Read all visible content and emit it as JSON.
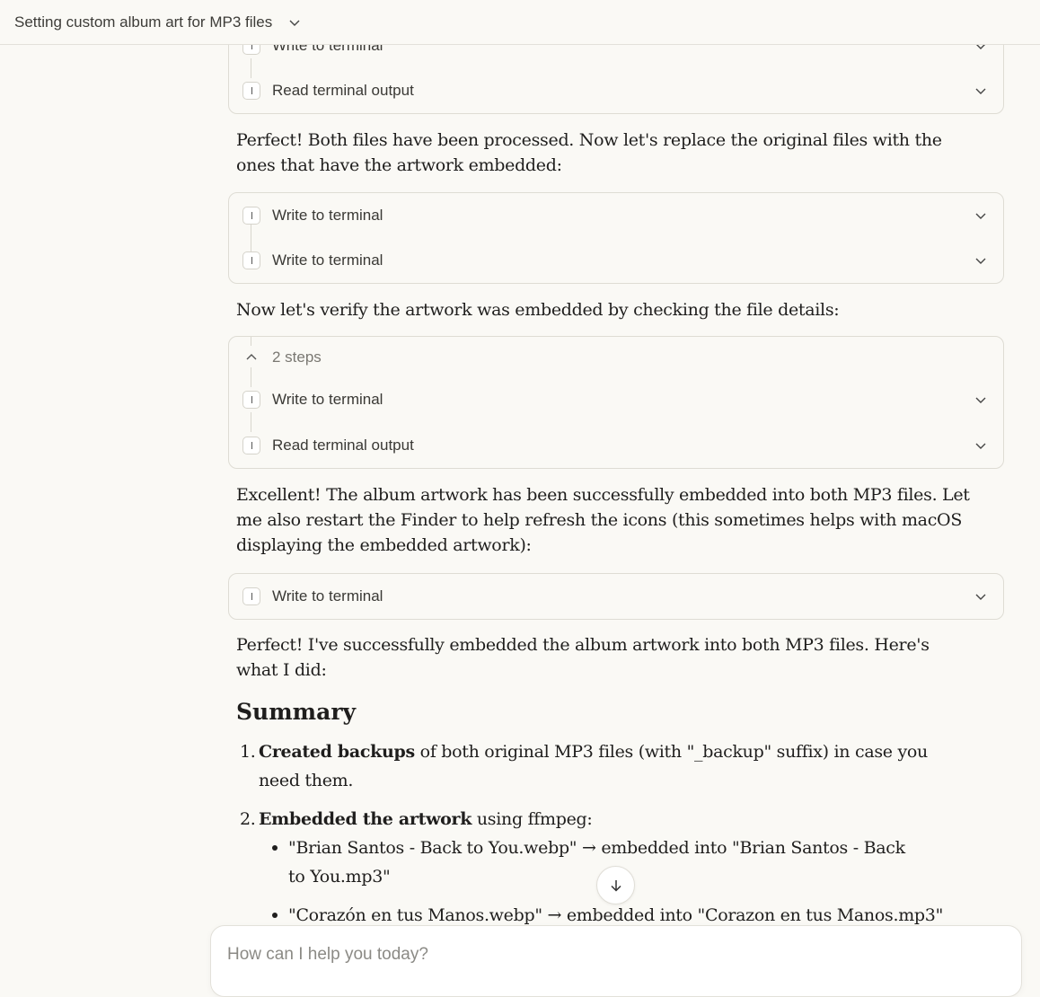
{
  "header": {
    "title": "Setting custom album art for MP3 files"
  },
  "blocks": {
    "tool1": {
      "row1": "Write to terminal",
      "row2": "Read terminal output"
    },
    "p1": "Perfect! Both files have been processed. Now let's replace the original files with the ones that have the artwork embedded:",
    "tool2": {
      "row1": "Write to terminal",
      "row2": "Write to terminal"
    },
    "p2": "Now let's verify the artwork was embedded by checking the file details:",
    "tool3": {
      "steps": "2 steps",
      "row1": "Write to terminal",
      "row2": "Read terminal output"
    },
    "p3": "Excellent! The album artwork has been successfully embedded into both MP3 files. Let me also restart the Finder to help refresh the icons (this sometimes helps with macOS displaying the embedded artwork):",
    "tool4": {
      "row1": "Write to terminal"
    },
    "p4": "Perfect! I've successfully embedded the album artwork into both MP3 files. Here's what I did:",
    "summary_heading": "Summary",
    "list": {
      "item1_num": "1.",
      "item1_bold": "Created backups",
      "item1_rest": " of both original MP3 files (with \"_backup\" suffix) in case you need them.",
      "item2_num": "2.",
      "item2_bold": "Embedded the artwork",
      "item2_rest": " using ffmpeg:",
      "sub1": "\"Brian Santos - Back to You.webp\" → embedded into \"Brian Santos - Back to You.mp3\"",
      "sub2": "\"Corazón en tus Manos.webp\" → embedded into \"Corazon en tus Manos.mp3\""
    }
  },
  "composer": {
    "placeholder": "How can I help you today?"
  },
  "icons": {
    "header": "chevron-down-icon",
    "scroll": "arrow-down-icon",
    "expand": "chevron-down-icon",
    "collapse": "chevron-up-icon"
  }
}
